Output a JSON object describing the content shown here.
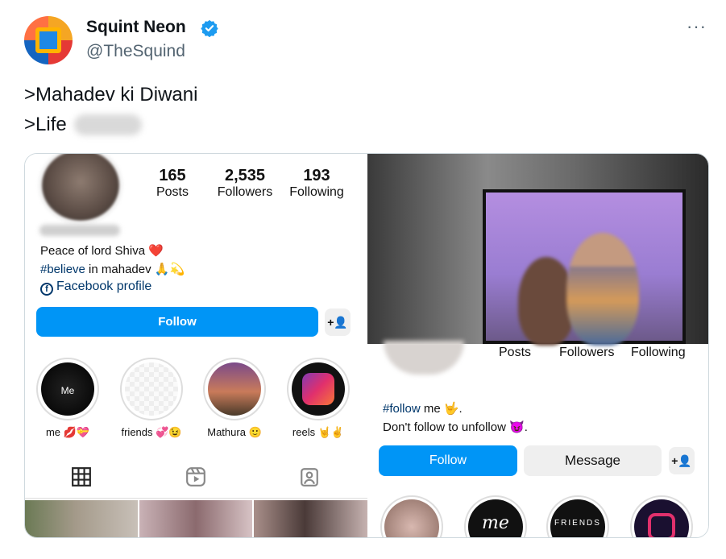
{
  "tweet": {
    "author_name": "Squint Neon",
    "author_handle": "@TheSquind",
    "more_label": "···",
    "lines": [
      ">Mahadev ki Diwani",
      ">Life"
    ]
  },
  "left_profile": {
    "stats": [
      {
        "value": "165",
        "label": "Posts"
      },
      {
        "value": "2,535",
        "label": "Followers"
      },
      {
        "value": "193",
        "label": "Following"
      }
    ],
    "bio_line1": "Peace of lord Shiva ❤️",
    "bio_tag": "#believe",
    "bio_line2_rest": " in mahadev 🙏💫",
    "facebook_label": "Facebook profile",
    "follow_label": "Follow",
    "add_user_label": "+👤",
    "highlights": [
      {
        "label": "me 💋💝",
        "inner_text": "Me"
      },
      {
        "label": "friends 💞😉",
        "inner_text": ""
      },
      {
        "label": "Mathura 🙂",
        "inner_text": ""
      },
      {
        "label": "reels 🤘✌️",
        "inner_text": ""
      }
    ],
    "tab_icons": [
      "grid-icon",
      "reels-icon",
      "tagged-icon"
    ]
  },
  "right_profile": {
    "labels": [
      "Posts",
      "Followers",
      "Following"
    ],
    "bio_tag": "#follow",
    "bio_line1_rest": " me 🤟.",
    "bio_line2": "Don't follow to unfollow 😈.",
    "follow_label": "Follow",
    "message_label": "Message",
    "add_user_label": "+👤",
    "highlight_texts": [
      "",
      "me",
      "FRIENDS",
      ""
    ]
  },
  "colors": {
    "accent_blue": "#0095f6",
    "verified_blue": "#1d9bf0",
    "link_blue": "#00376b"
  }
}
